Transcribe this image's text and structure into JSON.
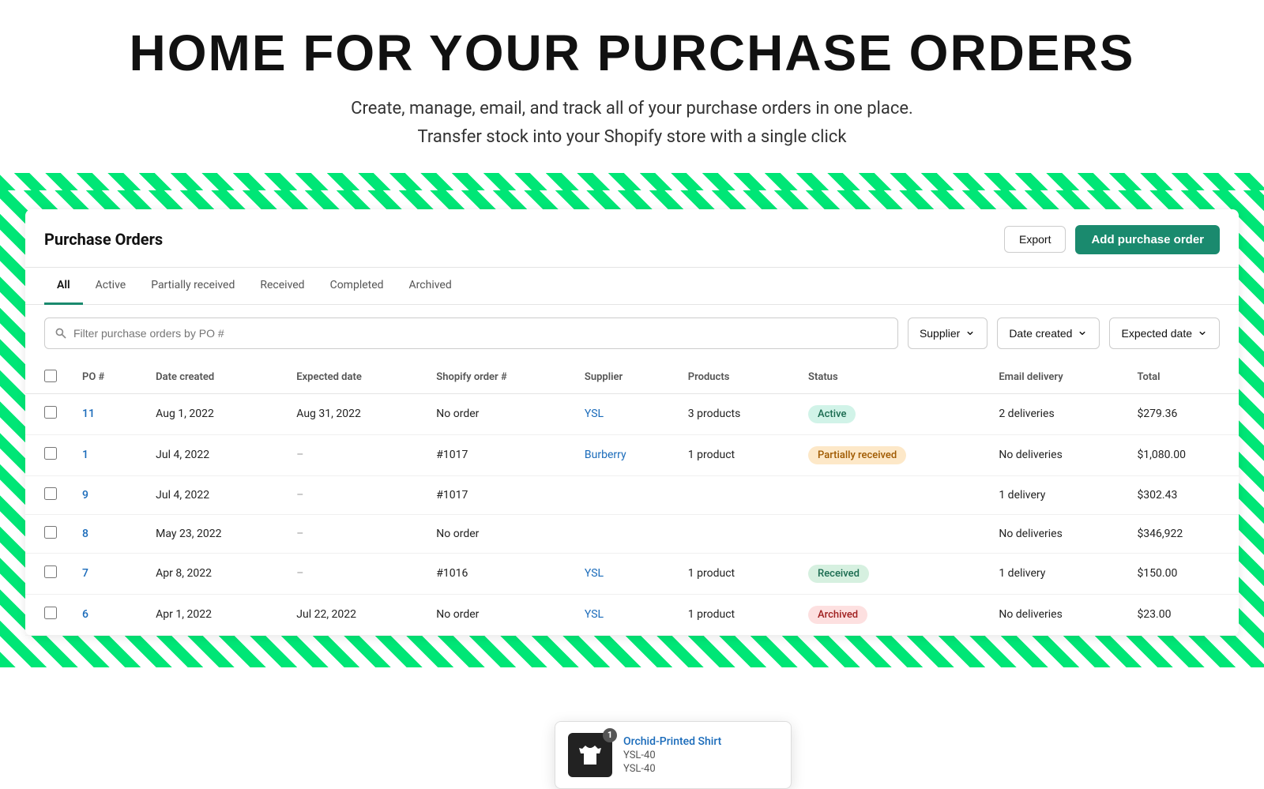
{
  "hero": {
    "title": "HOME  FOR  YOUR  PURCHASE  ORDERS",
    "subtitle_line1": "Create, manage, email, and track all of your purchase orders in one place.",
    "subtitle_line2": "Transfer stock into your Shopify store with a single click"
  },
  "header": {
    "title": "Purchase Orders",
    "export_label": "Export",
    "add_label": "Add purchase order"
  },
  "tabs": [
    {
      "label": "All",
      "active": true
    },
    {
      "label": "Active",
      "active": false
    },
    {
      "label": "Partially received",
      "active": false
    },
    {
      "label": "Received",
      "active": false
    },
    {
      "label": "Completed",
      "active": false
    },
    {
      "label": "Archived",
      "active": false
    }
  ],
  "filters": {
    "search_placeholder": "Filter purchase orders by PO #",
    "supplier_label": "Supplier",
    "date_created_label": "Date created",
    "expected_date_label": "Expected date"
  },
  "table": {
    "columns": [
      "PO #",
      "Date created",
      "Expected date",
      "Shopify order #",
      "Supplier",
      "Products",
      "Status",
      "Email delivery",
      "Total"
    ],
    "rows": [
      {
        "po": "11",
        "date_created": "Aug 1, 2022",
        "expected_date": "Aug 31, 2022",
        "shopify_order": "No order",
        "supplier": "YSL",
        "products": "3 products",
        "status": "Active",
        "status_class": "status-active",
        "email_delivery": "2 deliveries",
        "total": "$279.36"
      },
      {
        "po": "1",
        "date_created": "Jul 4, 2022",
        "expected_date": "–",
        "shopify_order": "#1017",
        "supplier": "Burberry",
        "products": "1 product",
        "status": "Partially received",
        "status_class": "status-partial",
        "email_delivery": "No deliveries",
        "total": "$1,080.00"
      },
      {
        "po": "9",
        "date_created": "Jul 4, 2022",
        "expected_date": "–",
        "shopify_order": "#1017",
        "supplier": "",
        "products": "",
        "status": "",
        "status_class": "",
        "email_delivery": "1 delivery",
        "total": "$302.43"
      },
      {
        "po": "8",
        "date_created": "May 23, 2022",
        "expected_date": "–",
        "shopify_order": "No order",
        "supplier": "",
        "products": "",
        "status": "",
        "status_class": "",
        "email_delivery": "No deliveries",
        "total": "$346,922"
      },
      {
        "po": "7",
        "date_created": "Apr 8, 2022",
        "expected_date": "–",
        "shopify_order": "#1016",
        "supplier": "YSL",
        "products": "1 product",
        "status": "Received",
        "status_class": "status-received",
        "email_delivery": "1 delivery",
        "total": "$150.00"
      },
      {
        "po": "6",
        "date_created": "Apr 1, 2022",
        "expected_date": "Jul 22, 2022",
        "shopify_order": "No order",
        "supplier": "YSL",
        "products": "1 product",
        "status": "Archived",
        "status_class": "status-archived",
        "email_delivery": "No deliveries",
        "total": "$23.00"
      }
    ]
  },
  "tooltip": {
    "badge_count": "1",
    "product_name": "Orchid-Printed Shirt",
    "sku1": "YSL-40",
    "sku2": "YSL-40"
  },
  "colors": {
    "accent_green": "#1a8a6e",
    "stripe_green": "#00e676"
  }
}
